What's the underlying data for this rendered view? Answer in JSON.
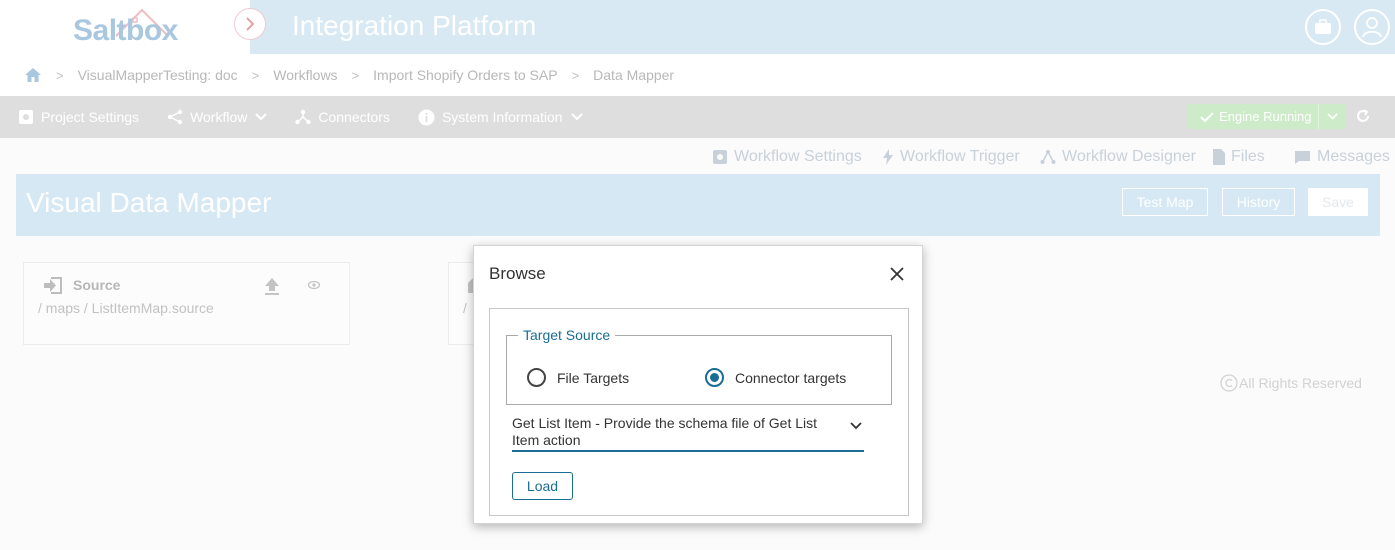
{
  "app": {
    "logo_text": "Saltbox",
    "title": "Integration Platform"
  },
  "breadcrumb": [
    "VisualMapperTesting: doc",
    "Workflows",
    "Import Shopify Orders to SAP",
    "Data Mapper"
  ],
  "toolbar": {
    "project_settings": "Project Settings",
    "workflow": "Workflow",
    "connectors": "Connectors",
    "system_information": "System Information",
    "engine_status": "Engine Running"
  },
  "subnav": {
    "workflow_settings": "Workflow Settings",
    "workflow_trigger": "Workflow Trigger",
    "workflow_designer": "Workflow Designer",
    "files": "Files",
    "messages": "Messages"
  },
  "page": {
    "title": "Visual Data Mapper",
    "test_map": "Test Map",
    "history": "History",
    "save": "Save"
  },
  "source_card": {
    "title": "Source",
    "path": "/ maps / ListItemMap.source"
  },
  "target_card": {
    "path_partial": "/"
  },
  "footer": {
    "rights": "All Rights Reserved"
  },
  "modal": {
    "title": "Browse",
    "legend": "Target Source",
    "option_file": "File Targets",
    "option_connector": "Connector targets",
    "selected_option": "Connector targets",
    "select_value": "Get List Item - Provide the schema file of Get List Item action",
    "load": "Load"
  },
  "colors": {
    "header_bg": "#d8e9f3",
    "accent": "#1a6d94",
    "engine_green": "#cdebc9"
  }
}
